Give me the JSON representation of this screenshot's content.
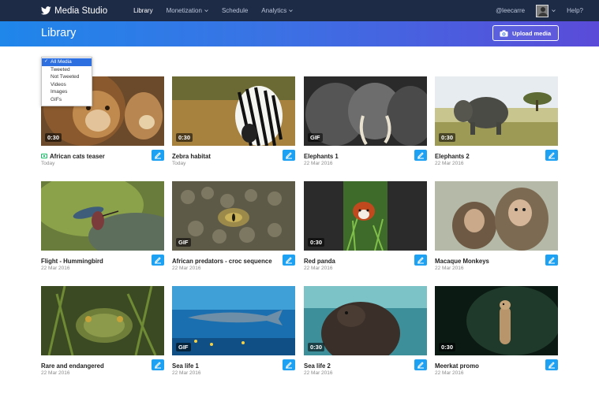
{
  "app": {
    "name": "Media Studio",
    "logo_icon": "twitter-bird-icon"
  },
  "nav": {
    "items": [
      {
        "label": "Library",
        "active": true,
        "has_dropdown": false
      },
      {
        "label": "Monetization",
        "active": false,
        "has_dropdown": true
      },
      {
        "label": "Schedule",
        "active": false,
        "has_dropdown": false
      },
      {
        "label": "Analytics",
        "active": false,
        "has_dropdown": true
      }
    ],
    "user_handle": "@leecarre",
    "help_label": "Help?"
  },
  "header": {
    "title": "Library",
    "upload_label": "Upload media",
    "upload_icon": "camera-icon"
  },
  "filter": {
    "options": [
      "All Media",
      "Tweeted",
      "Not Tweeted",
      "Videos",
      "Images",
      "GIFs"
    ],
    "selected": "All Media"
  },
  "media": [
    {
      "title": "African cats teaser",
      "date": "Today",
      "badge": "0:30",
      "type": "video",
      "tweeted_icon": true
    },
    {
      "title": "Zebra habitat",
      "date": "Today",
      "badge": "0:30",
      "type": "video"
    },
    {
      "title": "Elephants 1",
      "date": "22 Mar 2016",
      "badge": "GIF",
      "type": "gif"
    },
    {
      "title": "Elephants 2",
      "date": "22 Mar 2016",
      "badge": "0:30",
      "type": "video"
    },
    {
      "title": "Flight - Hummingbird",
      "date": "22 Mar 2016",
      "badge": "",
      "type": "image"
    },
    {
      "title": "African predators - croc sequence",
      "date": "22 Mar 2016",
      "badge": "GIF",
      "type": "gif"
    },
    {
      "title": "Red panda",
      "date": "22 Mar 2016",
      "badge": "0:30",
      "type": "video"
    },
    {
      "title": "Macaque Monkeys",
      "date": "22 Mar 2016",
      "badge": "",
      "type": "image"
    },
    {
      "title": "Rare and endangered",
      "date": "22 Mar 2016",
      "badge": "",
      "type": "image"
    },
    {
      "title": "Sea life 1",
      "date": "22 Mar 2016",
      "badge": "GIF",
      "type": "gif"
    },
    {
      "title": "Sea life 2",
      "date": "22 Mar 2016",
      "badge": "0:30",
      "type": "video"
    },
    {
      "title": "Meerkat promo",
      "date": "22 Mar 2016",
      "badge": "0:30",
      "type": "video"
    }
  ],
  "colors": {
    "nav_bg": "#1d2b47",
    "accent": "#1da1f2",
    "gradient_start": "#1f86ea",
    "gradient_end": "#5a4bd9",
    "tweeted_green": "#17bf63"
  }
}
